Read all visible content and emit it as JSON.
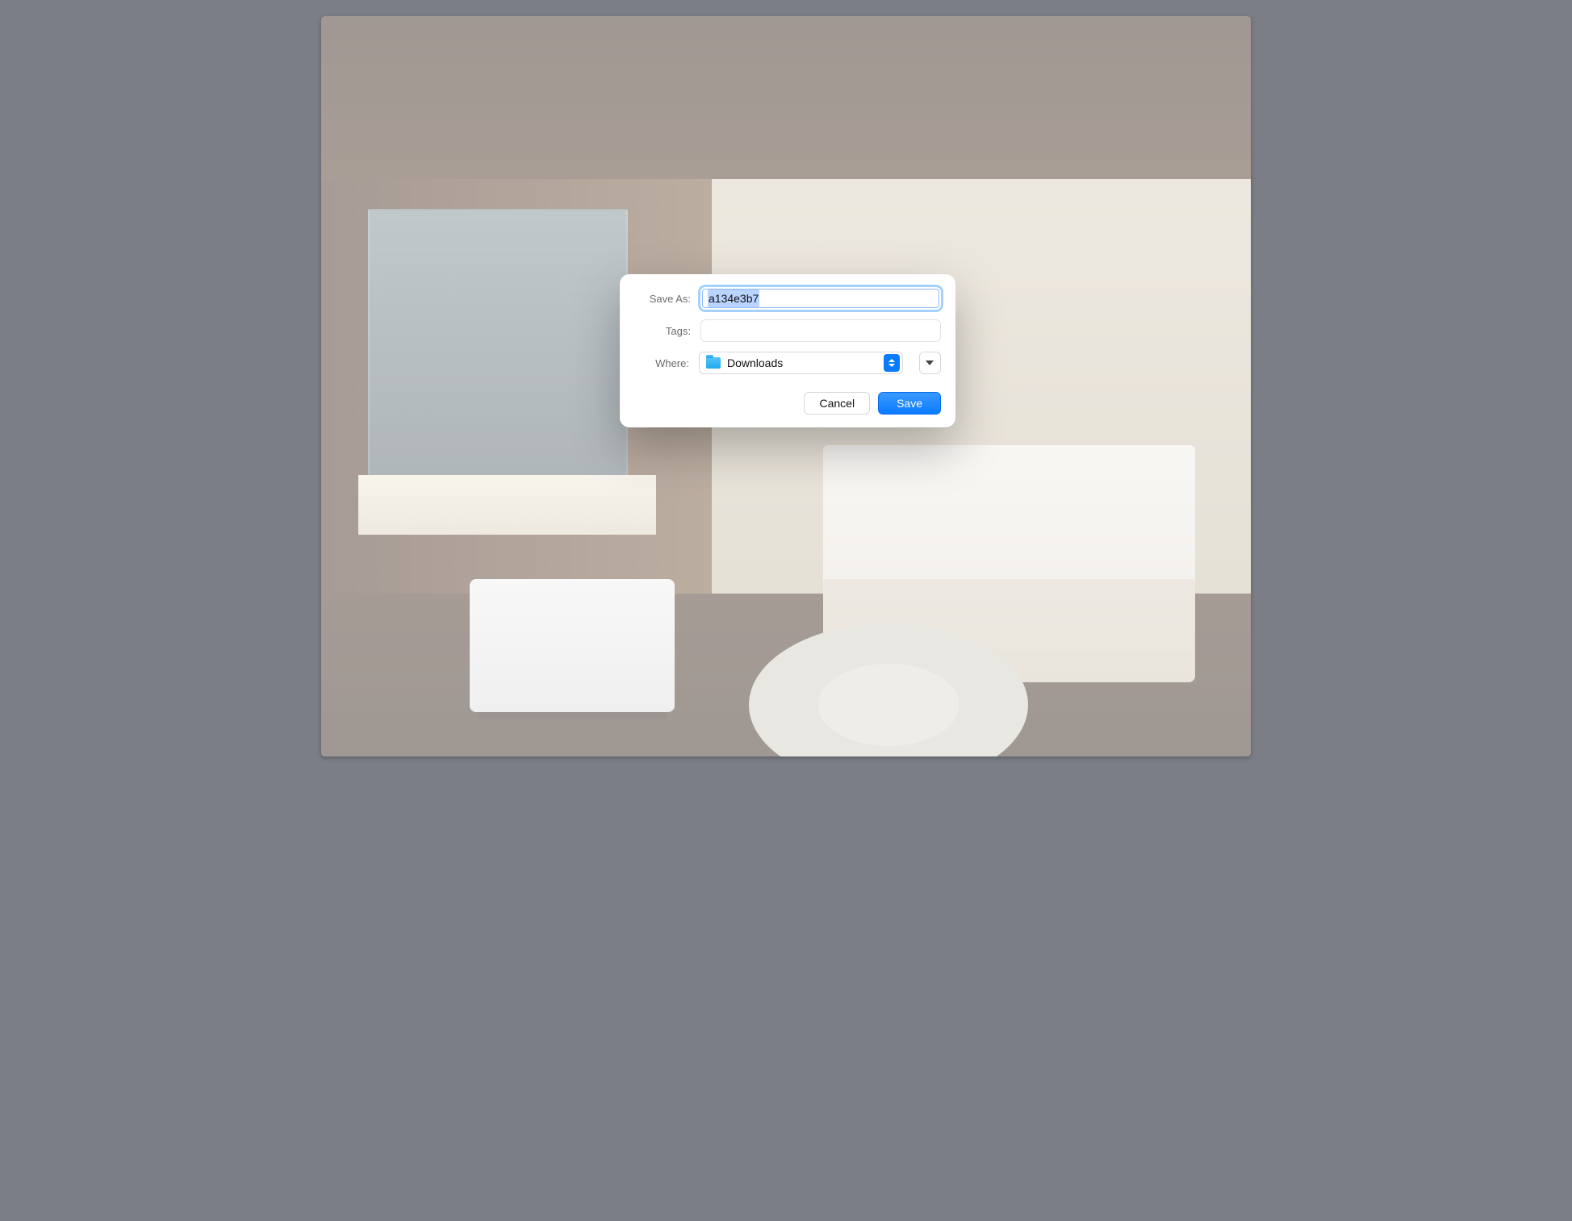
{
  "dialog": {
    "saveAsLabel": "Save As:",
    "saveAsValue": "a134e3b7",
    "tagsLabel": "Tags:",
    "tagsValue": "",
    "whereLabel": "Where:",
    "whereValue": "Downloads",
    "cancelLabel": "Cancel",
    "saveLabel": "Save"
  }
}
